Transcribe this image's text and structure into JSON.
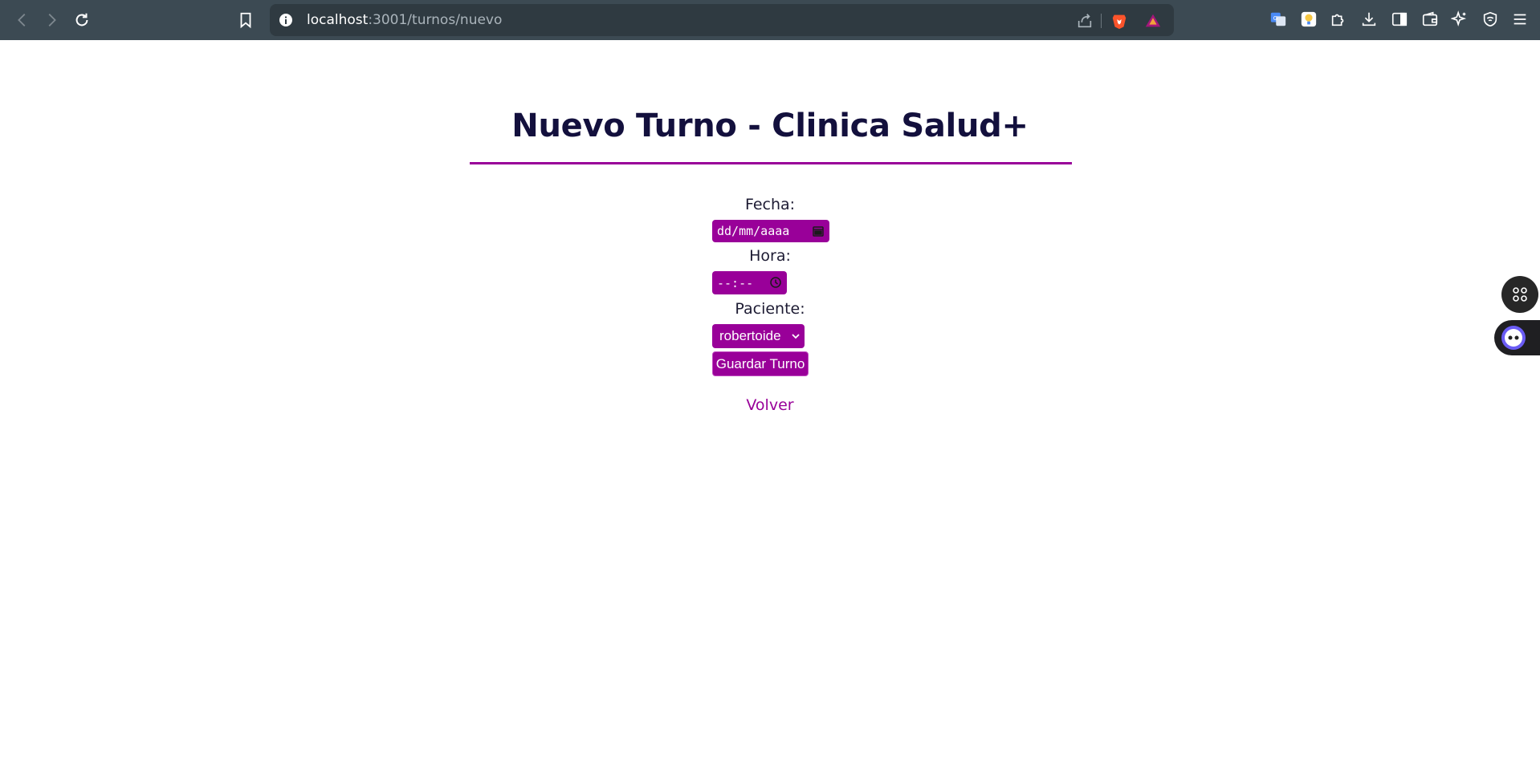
{
  "browser": {
    "url_host": "localhost",
    "url_path": ":3001/turnos/nuevo",
    "icons": {
      "back": "chevron-left-icon",
      "forward": "chevron-right-icon",
      "reload": "reload-icon",
      "bookmark": "bookmark-icon",
      "info": "info-icon",
      "share": "share-icon",
      "brave_shield": "brave-lion-icon",
      "brave_rewards": "triangle-icon"
    },
    "extensions": [
      "translate-icon",
      "lightbulb-icon",
      "puzzle-icon",
      "download-icon",
      "sidebar-icon",
      "wallet-icon",
      "sparkle-icon",
      "shield-icon",
      "menu-icon"
    ]
  },
  "page": {
    "title": "Nuevo Turno - Clinica Salud+",
    "accent_color": "#990099",
    "title_color": "#13103d",
    "form": {
      "fecha_label": "Fecha:",
      "fecha_placeholder": "dd/mm/aaaa",
      "hora_label": "Hora:",
      "hora_placeholder": "--:--",
      "paciente_label": "Paciente:",
      "paciente_selected": "robertoide",
      "submit_label": "Guardar Turno"
    },
    "back_link": "Volver"
  }
}
